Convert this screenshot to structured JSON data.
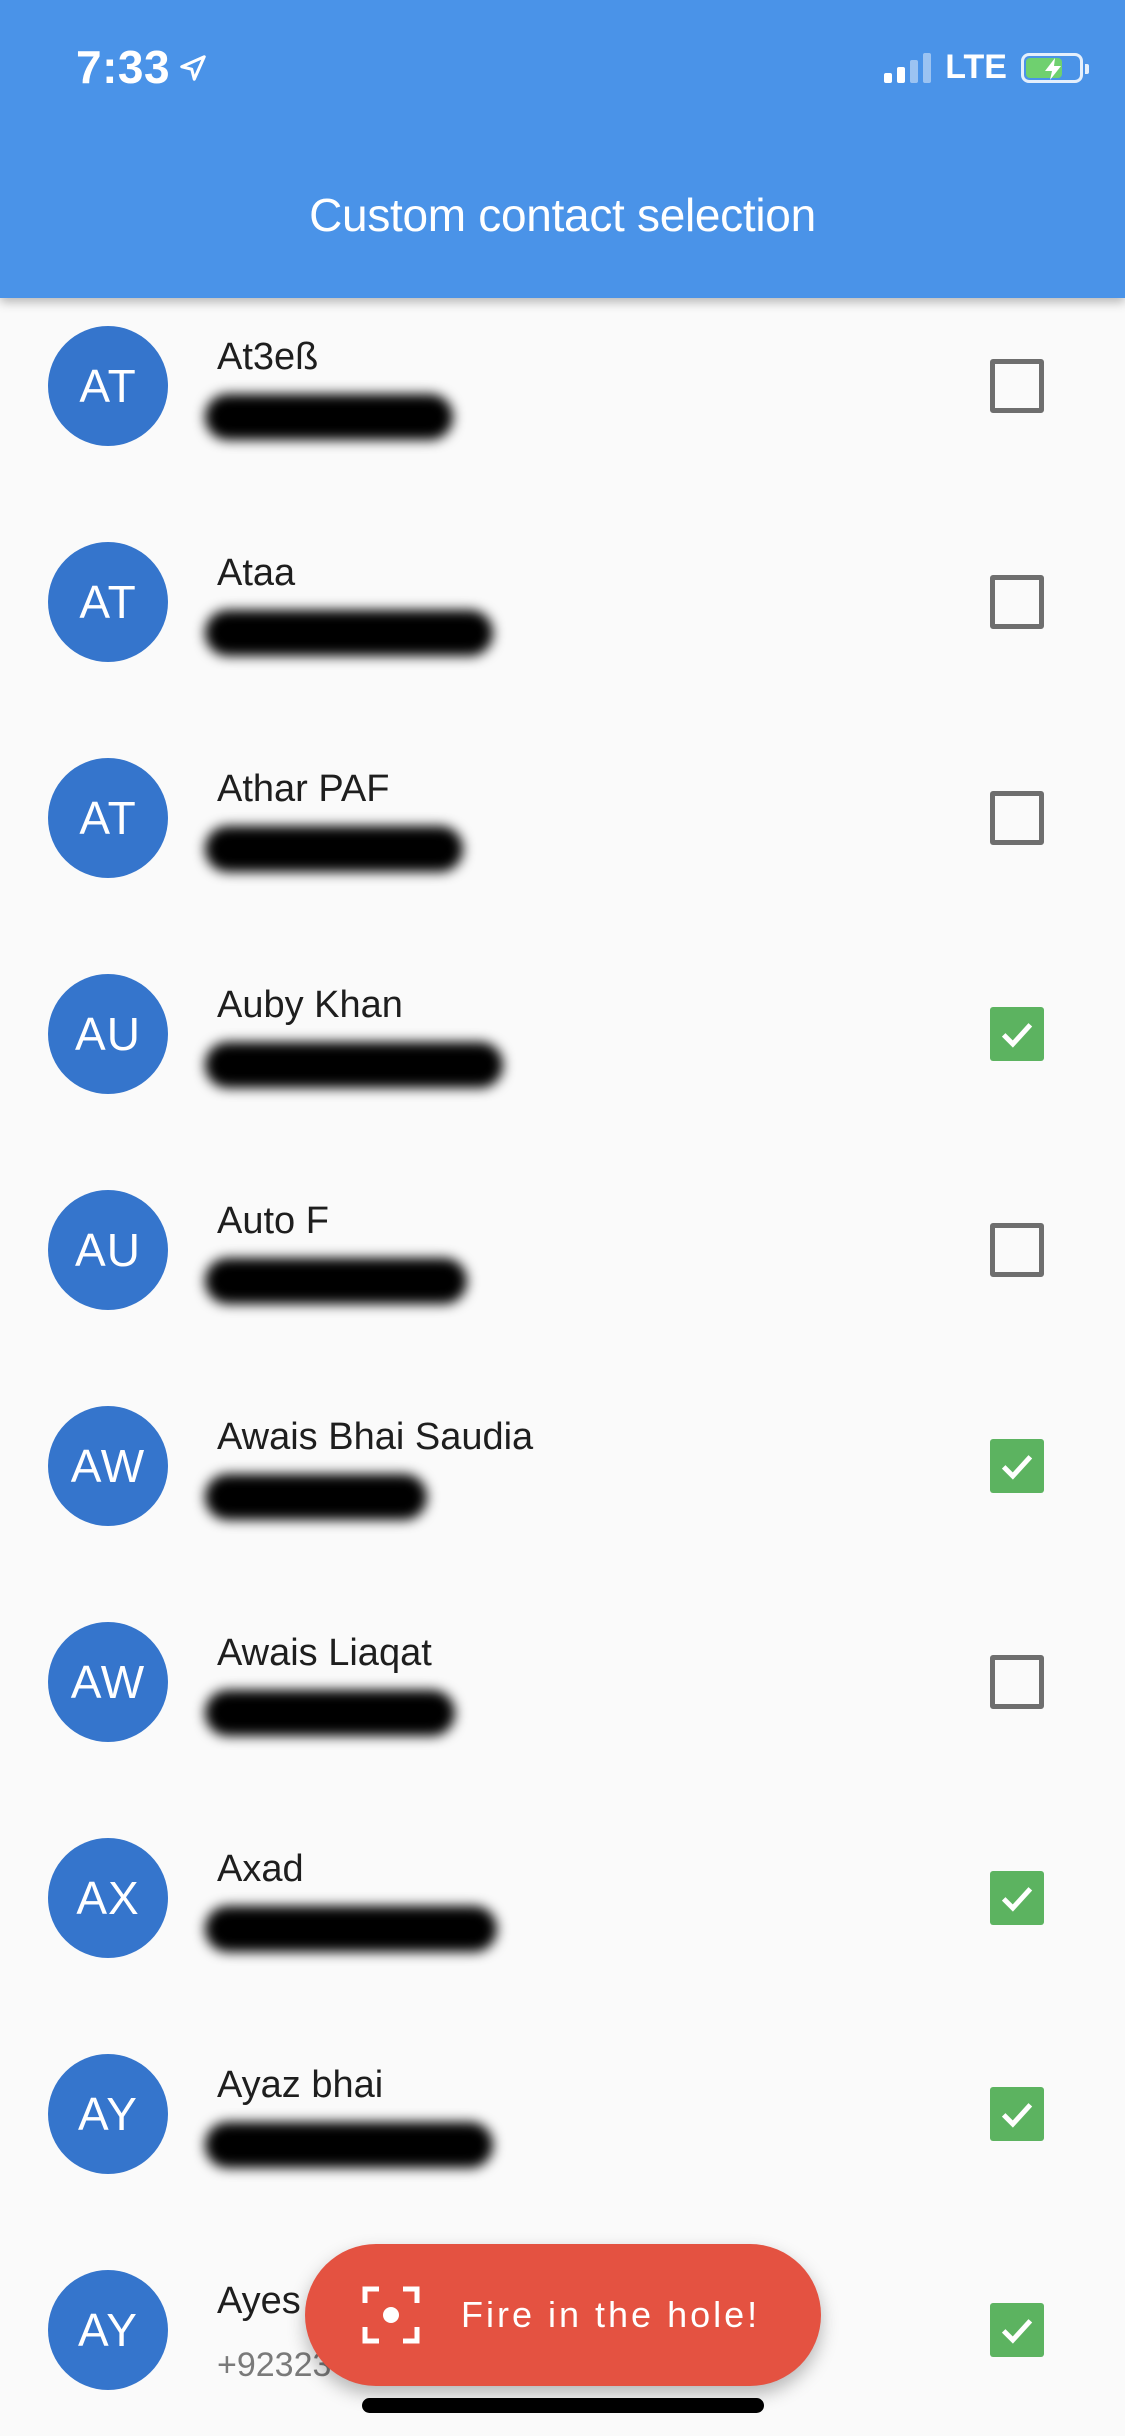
{
  "status_bar": {
    "time": "7:33",
    "network": "LTE",
    "location_icon": "location-arrow-icon",
    "battery_icon": "battery-charging-icon",
    "signal_icon": "cellular-signal-icon"
  },
  "header": {
    "title": "Custom contact selection"
  },
  "colors": {
    "appbar": "#4a93e8",
    "avatar": "#3575cc",
    "checked": "#5cb360",
    "fab": "#e45241"
  },
  "contacts": [
    {
      "initials": "AT",
      "name": "At3eß",
      "checked": false
    },
    {
      "initials": "AT",
      "name": "Ataa",
      "checked": false
    },
    {
      "initials": "AT",
      "name": "Athar PAF",
      "checked": false
    },
    {
      "initials": "AU",
      "name": "Auby Khan",
      "checked": true
    },
    {
      "initials": "AU",
      "name": "Auto F",
      "checked": false
    },
    {
      "initials": "AW",
      "name": "Awais Bhai Saudia",
      "checked": true
    },
    {
      "initials": "AW",
      "name": "Awais Liaqat",
      "checked": false
    },
    {
      "initials": "AX",
      "name": "Axad",
      "checked": true
    },
    {
      "initials": "AY",
      "name": "Ayaz bhai",
      "checked": true
    },
    {
      "initials": "AY",
      "name": "Ayes",
      "phone": "+92323",
      "checked": true
    }
  ],
  "fab": {
    "label": "Fire in the hole!",
    "icon": "focus-target-icon"
  }
}
